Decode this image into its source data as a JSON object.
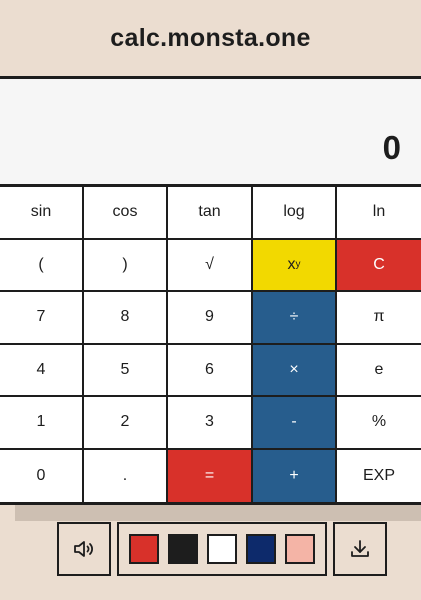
{
  "header": {
    "title": "calc.monsta.one"
  },
  "display": {
    "value": "0"
  },
  "keys": [
    {
      "label": "sin",
      "name": "sin-key",
      "style": ""
    },
    {
      "label": "cos",
      "name": "cos-key",
      "style": ""
    },
    {
      "label": "tan",
      "name": "tan-key",
      "style": ""
    },
    {
      "label": "log",
      "name": "log-key",
      "style": ""
    },
    {
      "label": "ln",
      "name": "ln-key",
      "style": ""
    },
    {
      "label": "(",
      "name": "open-paren-key",
      "style": ""
    },
    {
      "label": ")",
      "name": "close-paren-key",
      "style": ""
    },
    {
      "label": "√",
      "name": "sqrt-key",
      "style": ""
    },
    {
      "label": "x",
      "sup": "y",
      "name": "power-key",
      "style": "yellow"
    },
    {
      "label": "C",
      "name": "clear-key",
      "style": "red"
    },
    {
      "label": "7",
      "name": "digit-7-key",
      "style": ""
    },
    {
      "label": "8",
      "name": "digit-8-key",
      "style": ""
    },
    {
      "label": "9",
      "name": "digit-9-key",
      "style": ""
    },
    {
      "label": "÷",
      "name": "divide-key",
      "style": "blue"
    },
    {
      "label": "π",
      "name": "pi-key",
      "style": ""
    },
    {
      "label": "4",
      "name": "digit-4-key",
      "style": ""
    },
    {
      "label": "5",
      "name": "digit-5-key",
      "style": ""
    },
    {
      "label": "6",
      "name": "digit-6-key",
      "style": ""
    },
    {
      "label": "×",
      "name": "multiply-key",
      "style": "blue"
    },
    {
      "label": "e",
      "name": "e-key",
      "style": ""
    },
    {
      "label": "1",
      "name": "digit-1-key",
      "style": ""
    },
    {
      "label": "2",
      "name": "digit-2-key",
      "style": ""
    },
    {
      "label": "3",
      "name": "digit-3-key",
      "style": ""
    },
    {
      "label": "-",
      "name": "subtract-key",
      "style": "blue"
    },
    {
      "label": "%",
      "name": "percent-key",
      "style": ""
    },
    {
      "label": "0",
      "name": "digit-0-key",
      "style": ""
    },
    {
      "label": ".",
      "name": "decimal-key",
      "style": ""
    },
    {
      "label": "=",
      "name": "equals-key",
      "style": "red"
    },
    {
      "label": "+",
      "name": "add-key",
      "style": "blue"
    },
    {
      "label": "EXP",
      "name": "exp-key",
      "style": ""
    }
  ],
  "toolbar": {
    "sound_icon": "speaker-icon",
    "download_icon": "download-icon",
    "swatches": [
      {
        "name": "swatch-red",
        "color": "#d8312a"
      },
      {
        "name": "swatch-black",
        "color": "#1d1d1d"
      },
      {
        "name": "swatch-white",
        "color": "#ffffff"
      },
      {
        "name": "swatch-navy",
        "color": "#0d2a6b"
      },
      {
        "name": "swatch-pink",
        "color": "#f4b4a6"
      }
    ]
  },
  "colors": {
    "background": "#ebddd0",
    "accent_yellow": "#f2d900",
    "accent_red": "#d8312a",
    "accent_blue": "#275d8d"
  }
}
